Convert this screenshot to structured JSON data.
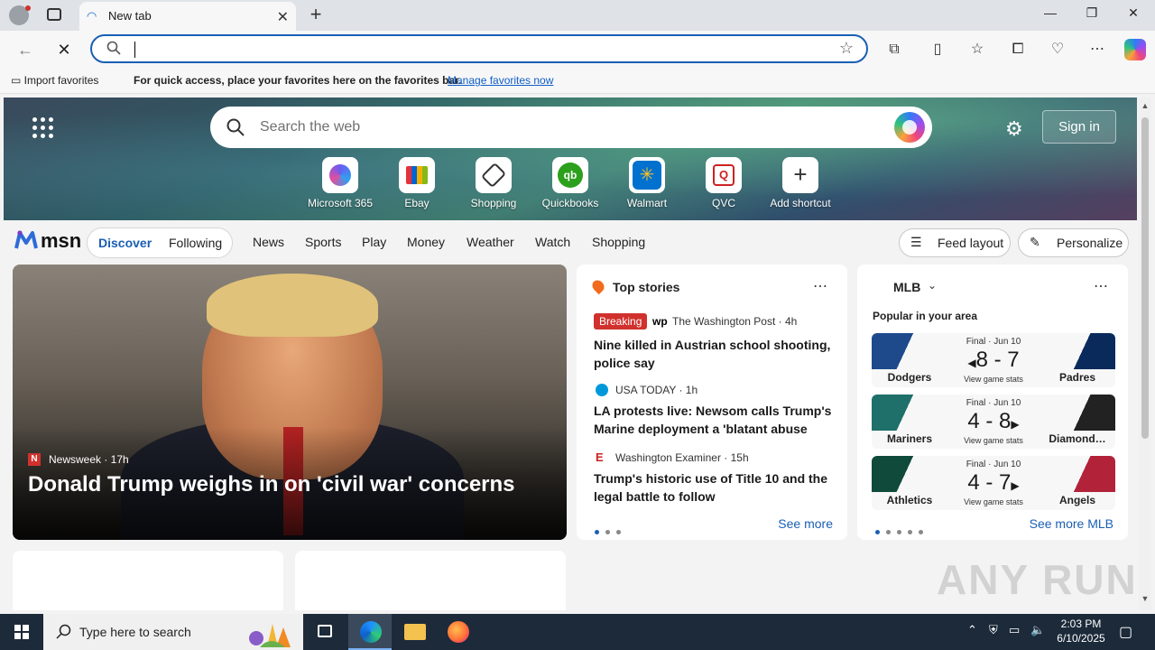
{
  "browser": {
    "tab_title": "New tab",
    "address_value": "",
    "favorites_bar": {
      "import_label": "Import favorites",
      "message": "For quick access, place your favorites here on the favorites bar.",
      "link": "Manage favorites now"
    }
  },
  "header": {
    "search_placeholder": "Search the web",
    "signin_label": "Sign in",
    "shortcuts": [
      {
        "label": "Microsoft 365",
        "icon": "microsoft-365-icon"
      },
      {
        "label": "Ebay",
        "icon": "ebay-icon"
      },
      {
        "label": "Shopping",
        "icon": "shopping-tag-icon"
      },
      {
        "label": "Quickbooks",
        "icon": "quickbooks-icon"
      },
      {
        "label": "Walmart",
        "icon": "walmart-icon"
      },
      {
        "label": "QVC",
        "icon": "qvc-icon"
      },
      {
        "label": "Add shortcut",
        "icon": "plus-icon"
      }
    ]
  },
  "msn": {
    "logo": "msn",
    "tabs": {
      "discover": "Discover",
      "following": "Following"
    },
    "nav": [
      "News",
      "Sports",
      "Play",
      "Money",
      "Weather",
      "Watch",
      "Shopping"
    ],
    "feed_layout": "Feed layout",
    "personalize": "Personalize"
  },
  "feature": {
    "source": "Newsweek · 17h",
    "source_initial": "N",
    "title": "Donald Trump weighs in on 'civil war' concerns"
  },
  "top_stories": {
    "heading": "Top stories",
    "breaking": "Breaking",
    "items": [
      {
        "source": "The Washington Post · 4h",
        "title": "Nine killed in Austrian school shooting, police say"
      },
      {
        "source": "USA TODAY · 1h",
        "title": "LA protests live: Newsom calls Trump's Marine deployment a 'blatant abuse of…"
      },
      {
        "source": "Washington Examiner · 15h",
        "title": "Trump's historic use of Title 10 and the legal battle to follow"
      }
    ],
    "see_more": "See more"
  },
  "mlb": {
    "heading": "MLB",
    "subheading": "Popular in your area",
    "games": [
      {
        "status": "Final · Jun 10",
        "score": "8 - 7",
        "winner_side": "left",
        "home": "Dodgers",
        "away": "Padres",
        "stats": "View game stats",
        "left_color": "#1e4a8c",
        "right_color": "#0a2a5c"
      },
      {
        "status": "Final · Jun 10",
        "score": "4 - 8",
        "winner_side": "right",
        "home": "Mariners",
        "away": "Diamond…",
        "stats": "View game stats",
        "left_color": "#1f6f6a",
        "right_color": "#222222"
      },
      {
        "status": "Final · Jun 10",
        "score": "4 - 7",
        "winner_side": "right",
        "home": "Athletics",
        "away": "Angels",
        "stats": "View game stats",
        "left_color": "#0f4a3a",
        "right_color": "#b2233a"
      }
    ],
    "see_more": "See more MLB"
  },
  "taskbar": {
    "search_placeholder": "Type here to search",
    "time": "2:03 PM",
    "date": "6/10/2025"
  },
  "watermark": "ANY RUN"
}
